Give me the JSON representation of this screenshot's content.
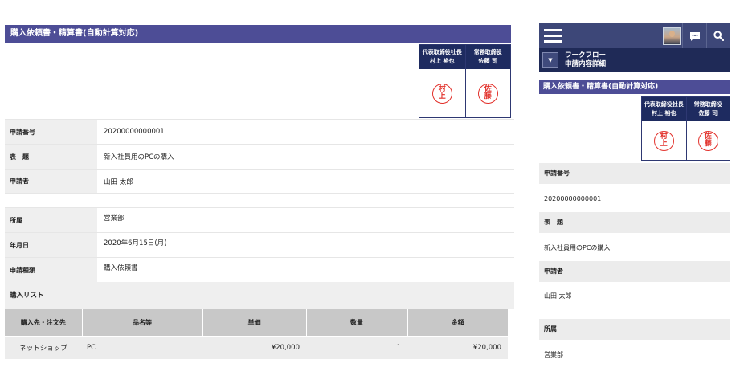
{
  "page_title": "購入依頼書・精算書(自動計算対応)",
  "approvers": [
    {
      "role": "代表取締役社長",
      "name": "村上 裕也",
      "seal": [
        "村",
        "上"
      ]
    },
    {
      "role": "常務取締役",
      "name": "佐藤 司",
      "seal": [
        "佐",
        "藤"
      ]
    }
  ],
  "fields": {
    "application_no": {
      "label": "申請番号",
      "value": "20200000000001"
    },
    "subject": {
      "label": "表　題",
      "value": "新入社員用のPCの購入"
    },
    "applicant": {
      "label": "申請者",
      "value": "山田 太郎"
    },
    "department": {
      "label": "所属",
      "value": "営業部"
    },
    "date": {
      "label": "年月日",
      "value": "2020年6月15日(月)"
    },
    "request_type": {
      "label": "申請種類",
      "value": "購入依頼書"
    }
  },
  "purchase_list": {
    "title": "購入リスト",
    "columns": [
      "購入先・注文先",
      "品名等",
      "単価",
      "数量",
      "金額"
    ],
    "rows": [
      [
        "ネットショップ",
        "PC",
        "¥20,000",
        "1",
        "¥20,000"
      ]
    ]
  },
  "mobile": {
    "header_icons": [
      "hamburger-menu-icon",
      "avatar",
      "chat-icon",
      "search-icon"
    ],
    "breadcrumb_parent": "ワークフロー",
    "breadcrumb_current": "申請内容詳細",
    "dropdown_glyph": "▼"
  },
  "colors": {
    "title_bar": "#4d4d96",
    "stamp_header": "#1e2b60",
    "mobile_header": "#3d4778",
    "seal_red": "#e2302a",
    "label_bg": "#efefef"
  }
}
